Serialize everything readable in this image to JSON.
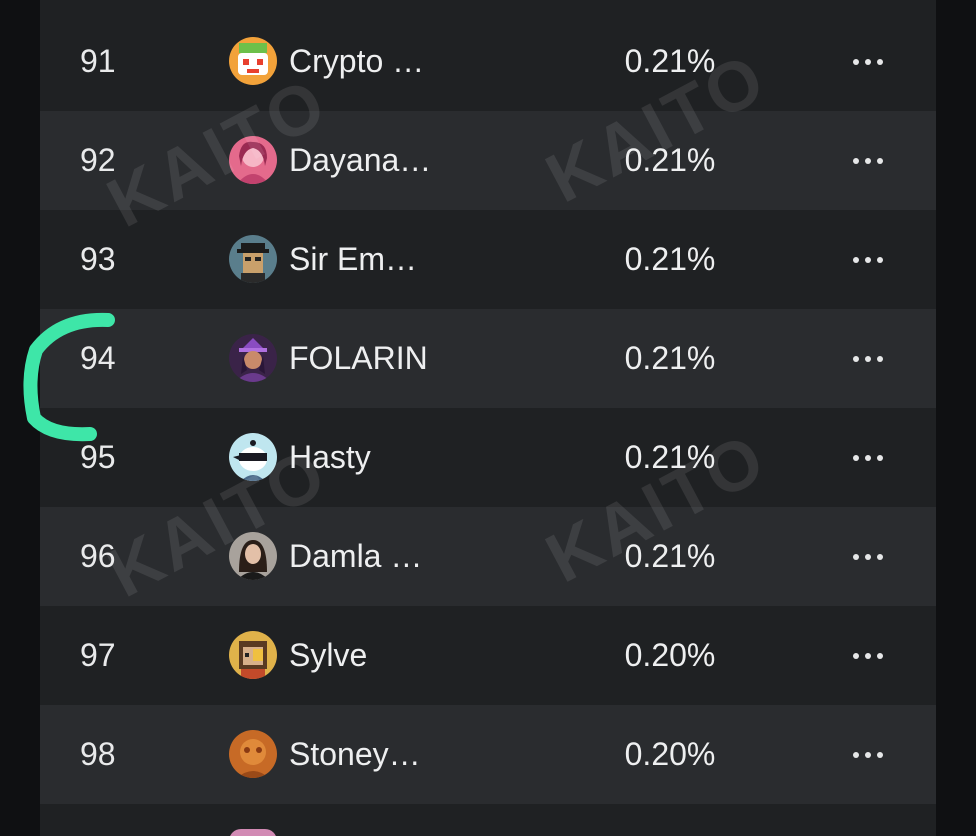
{
  "leaderboard": {
    "rows": [
      {
        "rank": "91",
        "name": "Crypto …",
        "share": "0.21%",
        "avatar": "crypto-avatar-icon",
        "avatar_color": "#f2a23a"
      },
      {
        "rank": "92",
        "name": "Dayana…",
        "share": "0.21%",
        "avatar": "dayana-avatar-icon",
        "avatar_color": "#e46a8c"
      },
      {
        "rank": "93",
        "name": "Sir Em…",
        "share": "0.21%",
        "avatar": "sir-em-avatar-icon",
        "avatar_color": "#5a7e8c"
      },
      {
        "rank": "94",
        "name": "FOLARIN",
        "share": "0.21%",
        "avatar": "folarin-avatar-icon",
        "avatar_color": "#6a3a8c"
      },
      {
        "rank": "95",
        "name": "Hasty",
        "share": "0.21%",
        "avatar": "hasty-avatar-icon",
        "avatar_color": "#bfe6ef"
      },
      {
        "rank": "96",
        "name": "Damla …",
        "share": "0.21%",
        "avatar": "damla-avatar-icon",
        "avatar_color": "#a8a29c"
      },
      {
        "rank": "97",
        "name": "Sylve",
        "share": "0.20%",
        "avatar": "sylve-avatar-icon",
        "avatar_color": "#e0b24a"
      },
      {
        "rank": "98",
        "name": "Stoney…",
        "share": "0.20%",
        "avatar": "stoney-avatar-icon",
        "avatar_color": "#c76a26"
      }
    ],
    "more_icon": "ellipsis-icon"
  },
  "watermark": "KAITO",
  "colors": {
    "background": "#0f1012",
    "row_dark": "#1f2123",
    "row_light": "#2a2c2f",
    "text": "#eeeff0",
    "highlight_mark": "#3ee6a8"
  }
}
